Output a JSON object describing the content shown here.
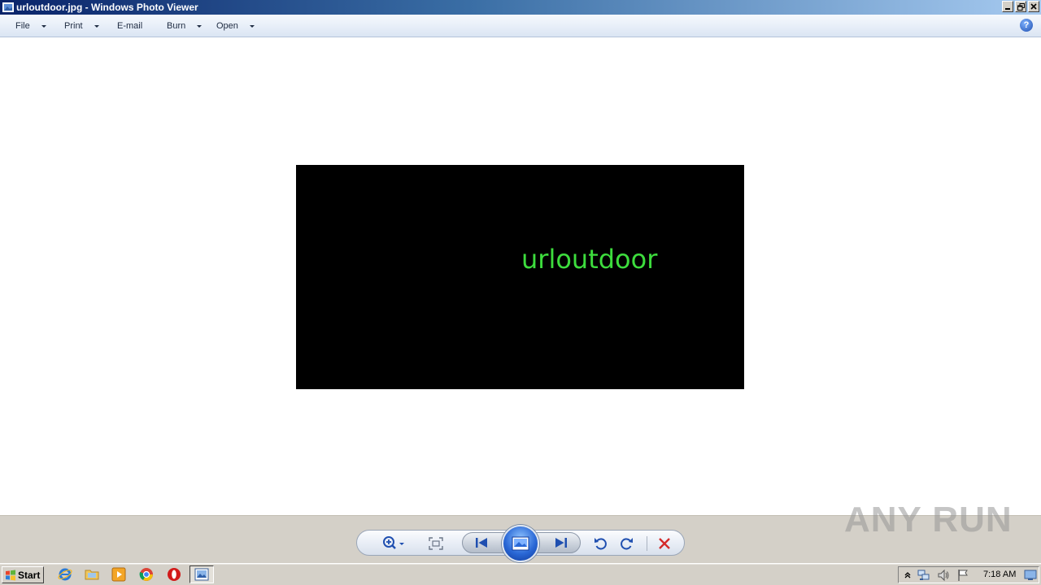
{
  "window": {
    "title": "urloutdoor.jpg - Windows Photo Viewer"
  },
  "menu": {
    "items": [
      {
        "label": "File",
        "has_dropdown": true
      },
      {
        "label": "Print",
        "has_dropdown": true
      },
      {
        "label": "E-mail",
        "has_dropdown": false
      },
      {
        "label": "Burn",
        "has_dropdown": true
      },
      {
        "label": "Open",
        "has_dropdown": true
      }
    ],
    "help_label": "?"
  },
  "photo": {
    "text": "urloutdoor",
    "background_color": "#000000",
    "text_color": "#3ddc3d"
  },
  "controls": {
    "icons": [
      "zoom-icon",
      "actual-size-icon",
      "previous-icon",
      "slideshow-icon",
      "next-icon",
      "rotate-counterclockwise-icon",
      "rotate-clockwise-icon",
      "delete-icon"
    ]
  },
  "watermark": {
    "text": "ANY RUN"
  },
  "taskbar": {
    "start_label": "Start",
    "clock": "7:18 AM",
    "pinned_icons": [
      "internet-explorer-icon",
      "explorer-folder-icon",
      "media-player-icon",
      "chrome-icon",
      "opera-icon",
      "photo-viewer-icon"
    ],
    "tray_icons": [
      "show-hidden-icon",
      "network-icon",
      "volume-icon",
      "action-center-flag-icon",
      "show-desktop-icon"
    ]
  },
  "colors": {
    "titlebar_start": "#0a246a",
    "titlebar_end": "#a6caf0",
    "menubar": "#e7eef8",
    "chrome": "#d4d0c8",
    "delete_red": "#d42a2a"
  }
}
